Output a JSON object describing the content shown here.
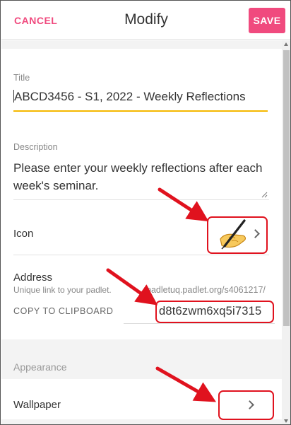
{
  "header": {
    "cancel_label": "CANCEL",
    "title": "Modify",
    "save_label": "SAVE"
  },
  "title_field": {
    "label": "Title",
    "value": "ABCD3456 - S1, 2022 - Weekly Reflections"
  },
  "description_field": {
    "label": "Description",
    "value": "Please enter your weekly reflections after each week's seminar."
  },
  "icon_row": {
    "label": "Icon",
    "icon": "pen-in-hand-icon"
  },
  "address": {
    "label": "Address",
    "hint": "Unique link to your padlet.",
    "link_prefix": "padletuq.padlet.org/s4061217/",
    "copy_label": "COPY TO CLIPBOARD",
    "slug": "d8t6zwm6xq5i7315"
  },
  "appearance": {
    "section_label": "Appearance",
    "wallpaper_label": "Wallpaper"
  },
  "colors": {
    "accent": "#f04a7e",
    "focus_underline": "#f5b800",
    "annotation_red": "#e0121e"
  }
}
